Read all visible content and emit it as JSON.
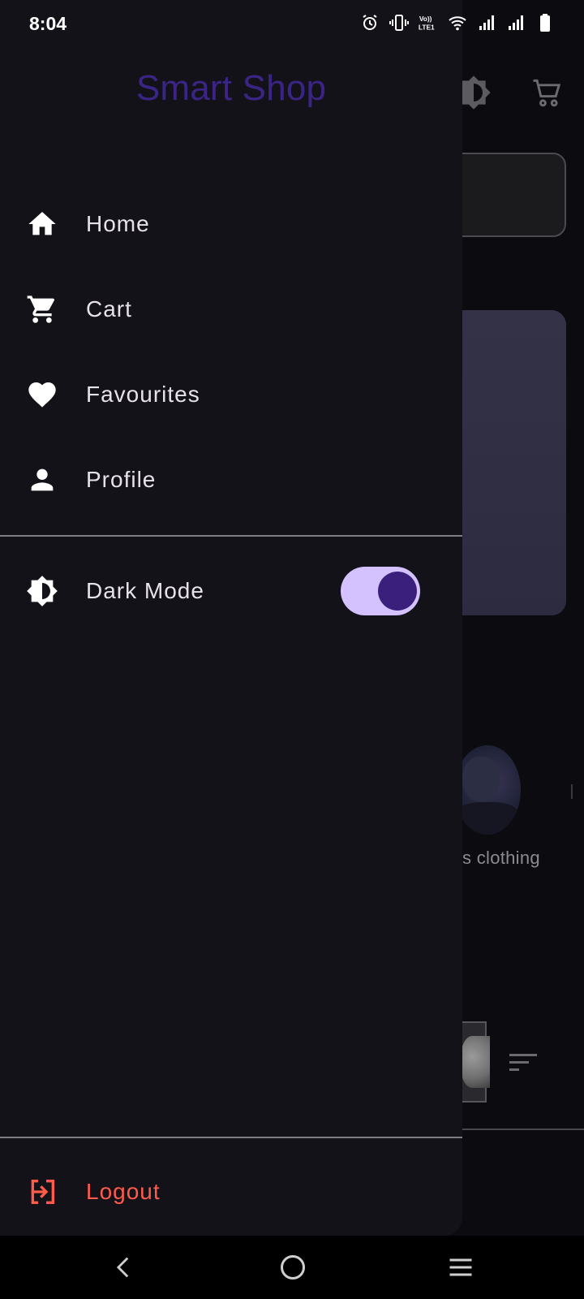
{
  "status_bar": {
    "time": "8:04",
    "icons": [
      "alarm-icon",
      "vibrate-icon",
      "volte-icon",
      "wifi-icon",
      "signal-icon",
      "signal-icon",
      "battery-icon"
    ]
  },
  "drawer": {
    "title": "Smart Shop",
    "items": [
      {
        "label": "Home",
        "icon": "home-icon"
      },
      {
        "label": "Cart",
        "icon": "cart-icon"
      },
      {
        "label": "Favourites",
        "icon": "heart-icon"
      },
      {
        "label": "Profile",
        "icon": "person-icon"
      }
    ],
    "dark_mode": {
      "label": "Dark Mode",
      "icon": "brightness-icon",
      "enabled": true
    },
    "logout": {
      "label": "Logout",
      "icon": "logout-icon",
      "color": "#ff5b4a"
    }
  },
  "background": {
    "category_caption": "s clothing"
  },
  "colors": {
    "title": "#3a2586",
    "drawer_bg": "#141219",
    "toggle_track": "#d3c2ff",
    "toggle_thumb": "#3b1f7c"
  },
  "system_nav": [
    "back-icon",
    "home-circle-icon",
    "recents-icon"
  ]
}
